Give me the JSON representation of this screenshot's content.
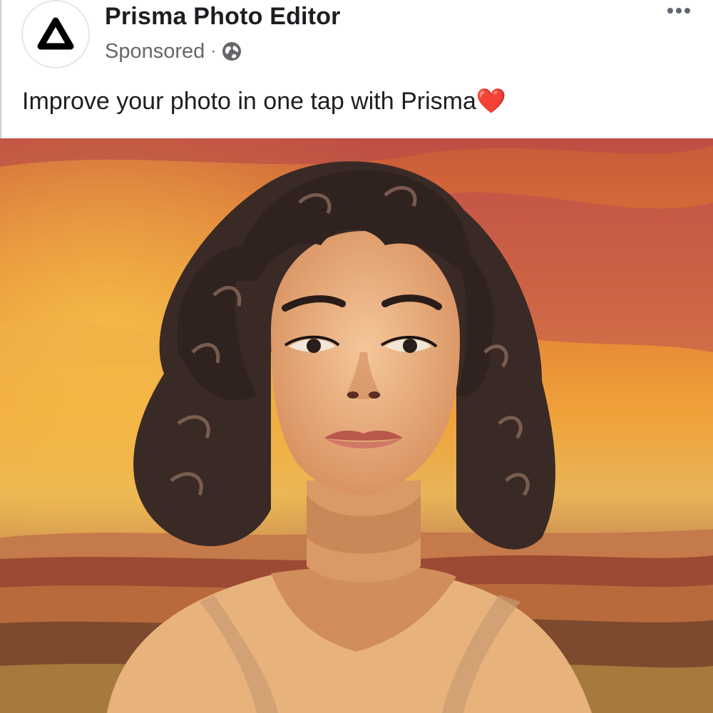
{
  "post": {
    "page_name": "Prisma Photo Editor",
    "meta": {
      "sponsored_label": "Sponsored",
      "separator": "·",
      "audience_icon": "globe-icon"
    },
    "caption": "Improve your photo in one tap with Prisma❤️",
    "avatar_icon": "prisma-logo-icon",
    "more_icon": "more-options-icon"
  },
  "colors": {
    "page_name": "#1c1e21",
    "meta_text": "#65676b",
    "logo": "#000000"
  }
}
